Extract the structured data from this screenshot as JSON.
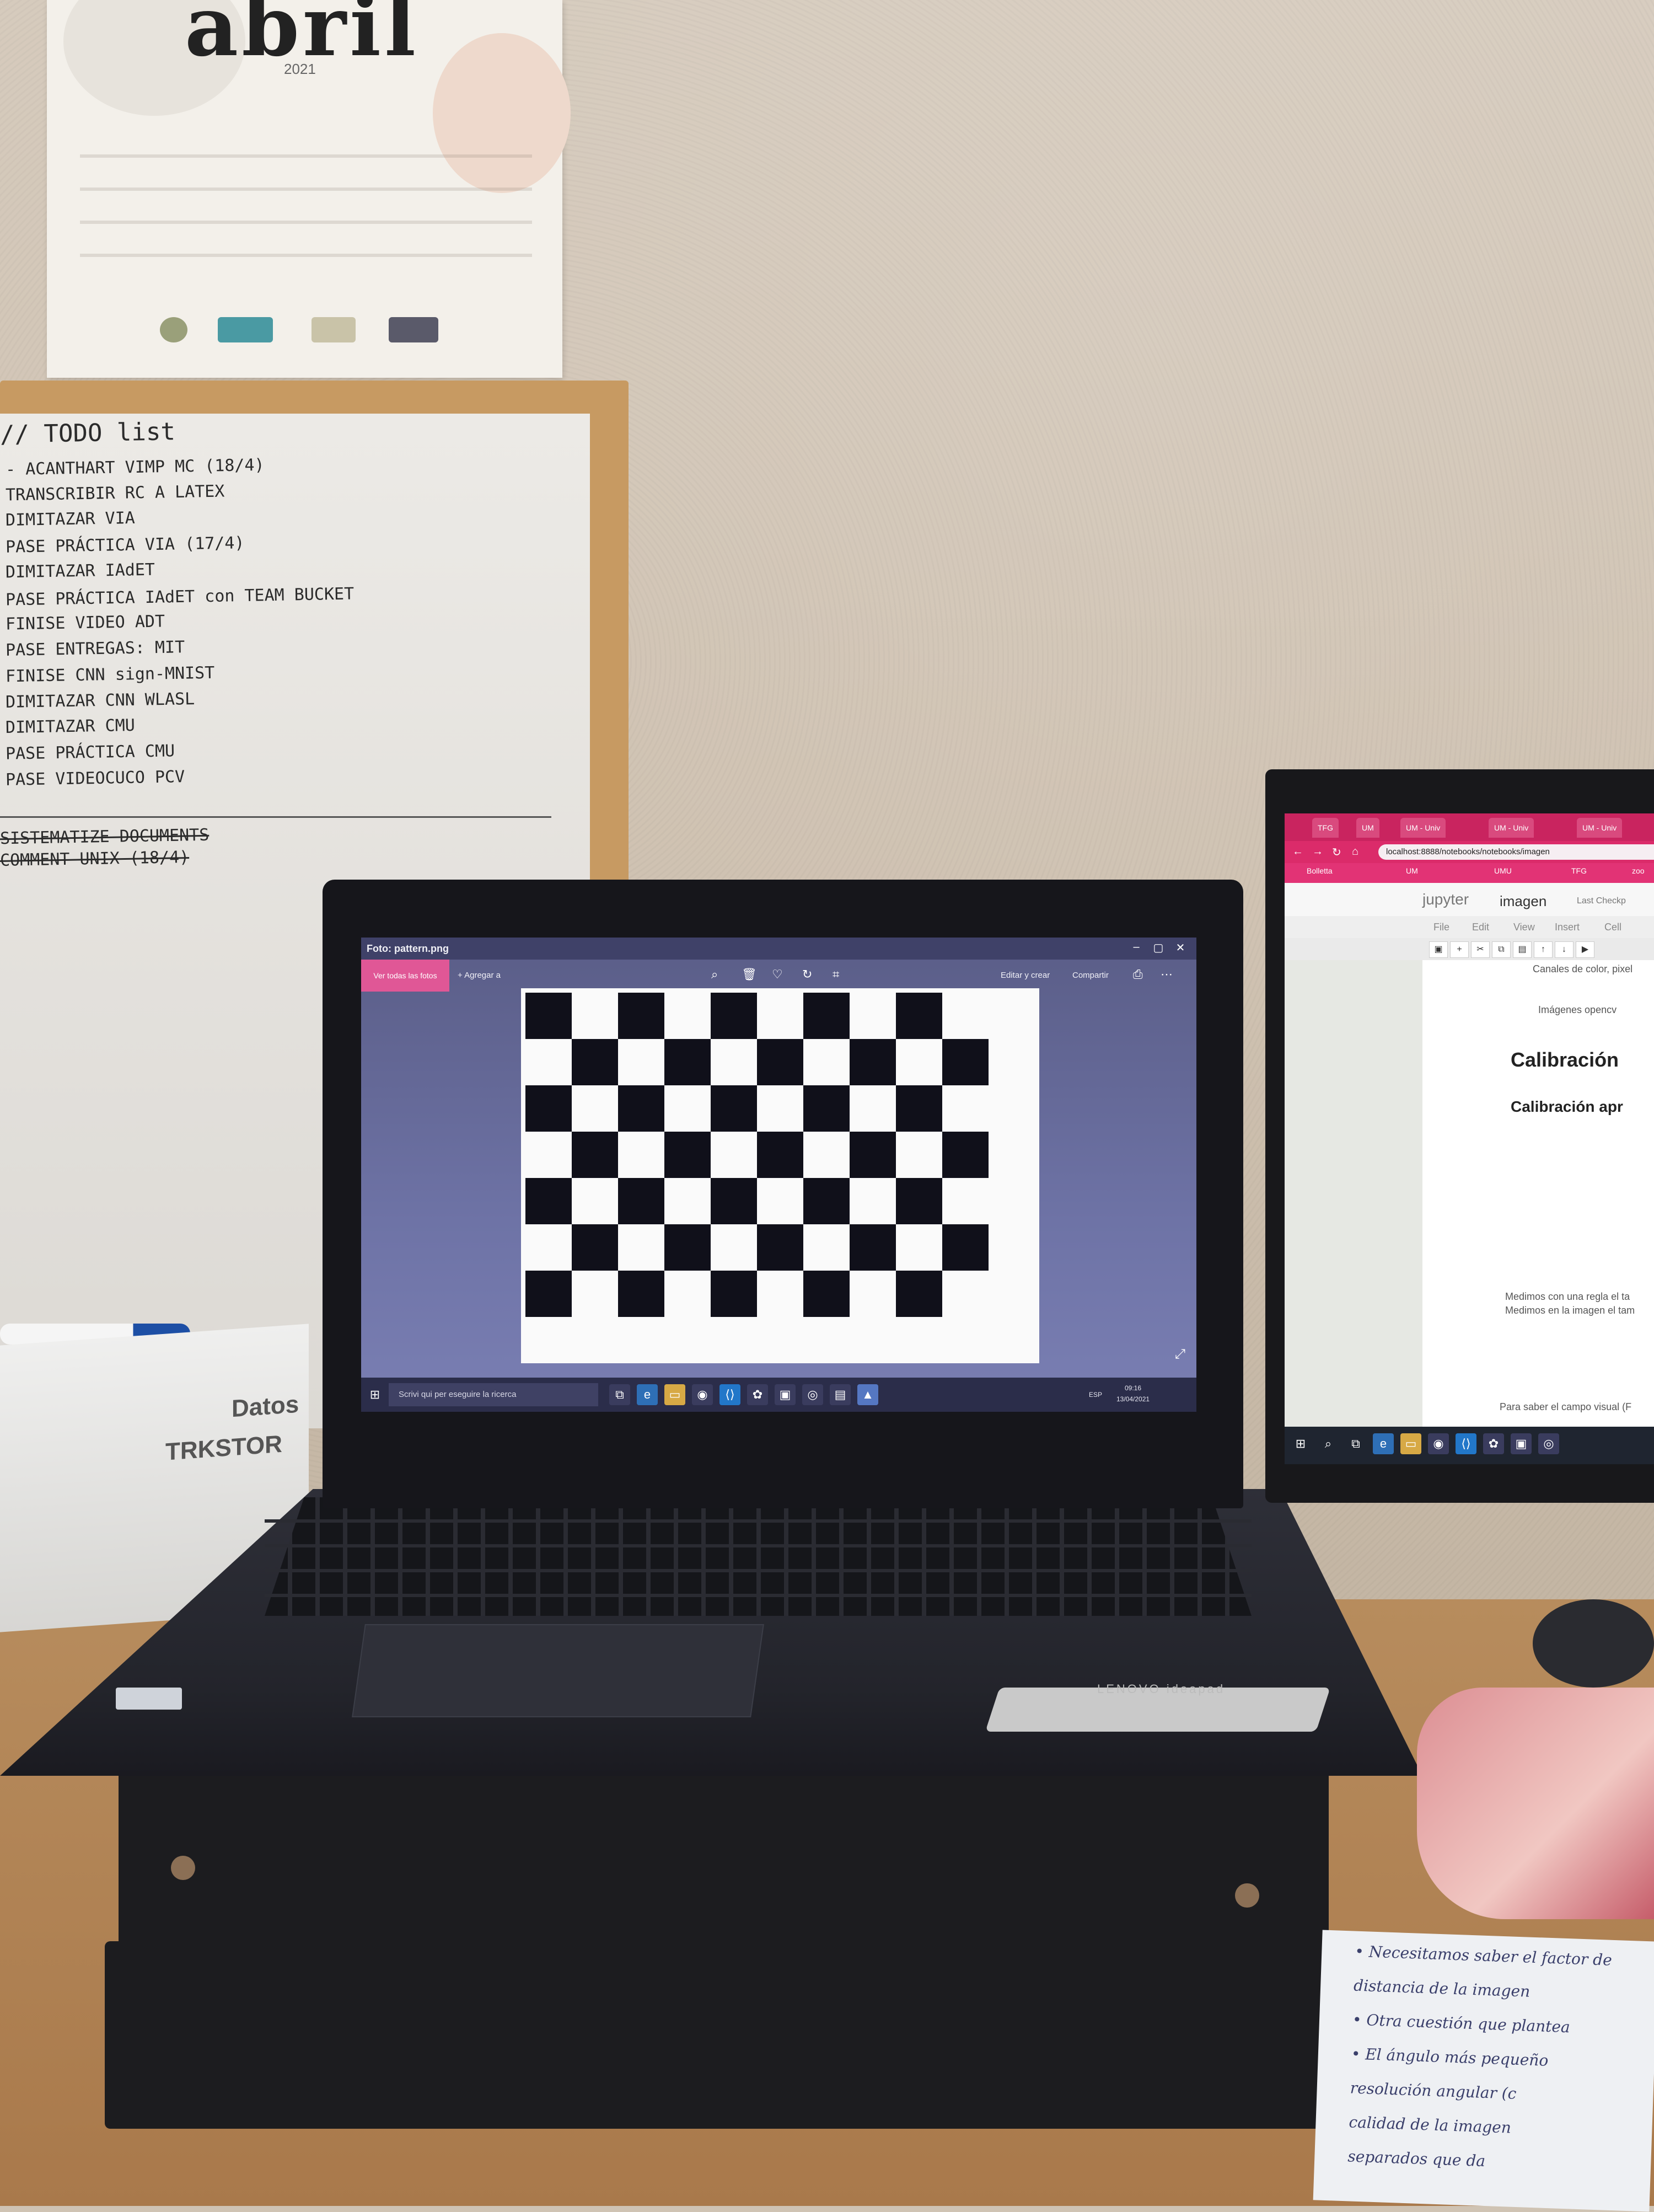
{
  "calendar": {
    "month": "abril",
    "year": "2021"
  },
  "whiteboard": {
    "title": "// TODO list",
    "items": [
      "- ACANTHART VIMP MC (18/4)",
      "TRANSCRIBIR RC A LATEX",
      "DIMITAZAR VIA",
      "PASE PRÁCTICA VIA (17/4)",
      "DIMITAZAR IAdET",
      "PASE PRÁCTICA IAdET con TEAM BUCKET",
      "FINISE VIDEO ADT",
      "PASE ENTREGAS: MIT",
      "FINISE CNN sign-MNIST",
      "DIMITAZAR CNN WLASL",
      "DIMITAZAR CMU",
      "PASE PRÁCTICA CMU",
      "PASE VIDEOCUCO PCV"
    ],
    "struck_items": [
      "SISTEMATIZE DOCUMENTS",
      "COMMENT UNIX (18/4)"
    ]
  },
  "laptop": {
    "window_title": "Foto: pattern.png",
    "see_all_photos": "Ver todas las fotos",
    "add_to": "Agregar a",
    "edit_create": "Editar y crear",
    "share": "Compartir",
    "taskbar_search": "Scrivi qui per eseguire la ricerca",
    "tray_lang": "ESP",
    "tray_time": "09:16",
    "tray_date": "13/04/2021",
    "brand": "LENOVO ideapad",
    "icons": [
      "zoom-icon",
      "trash-icon",
      "heart-icon",
      "rotate-icon",
      "crop-icon",
      "print-icon",
      "more-icon"
    ]
  },
  "checkerboard": {
    "rows": 7,
    "cols": 10
  },
  "monitor": {
    "tabs": [
      "TFG",
      "UM",
      "UM - Univ",
      "UM - Univ",
      "UM - Univ"
    ],
    "url": "localhost:8888/notebooks/notebooks/imagen",
    "bookmarks": [
      "Bolletta",
      "UM",
      "UMU",
      "TFG",
      "zoo"
    ],
    "jupyter_logo": "jupyter",
    "notebook_name": "imagen",
    "checkpoint": "Last Checkp",
    "menu": [
      "File",
      "Edit",
      "View",
      "Insert",
      "Cell"
    ],
    "lines": {
      "canales": "Canales de color, pixel",
      "imagenes": "Imágenes opencv",
      "h1": "Calibración",
      "h2": "Calibración apr",
      "medimos1": "Medimos con una regla el ta",
      "medimos2": "Medimos en la imagen el tam",
      "campo": "Para saber el campo visual (F"
    }
  },
  "box": {
    "brand": "TRKSTOR",
    "label": "Datos"
  },
  "notebook_paper": {
    "lines": [
      "• Necesitamos saber el factor de",
      "distancia de la imagen",
      "• Otra cuestión que plantea",
      "• El ángulo más pequeño",
      "resolución angular (c",
      "calidad de la imagen",
      "separados que da"
    ]
  }
}
